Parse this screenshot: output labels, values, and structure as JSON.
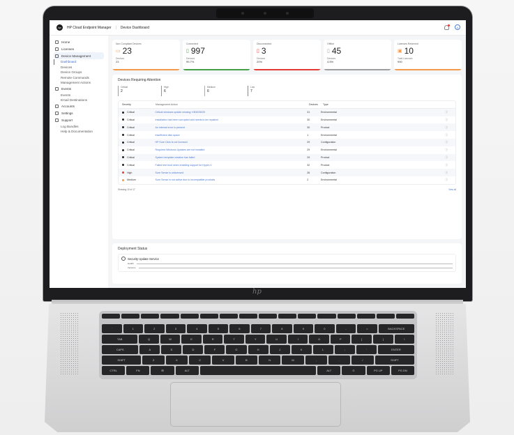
{
  "app": {
    "title": "HP Cloud Endpoint Manager",
    "page": "Device Dashboard",
    "logo_text": "hp",
    "avatar": "A"
  },
  "sidebar": {
    "items": [
      {
        "label": "Home",
        "icon": "home-icon"
      },
      {
        "label": "Licenses",
        "icon": "license-icon"
      },
      {
        "label": "Device Management",
        "icon": "device-icon",
        "active": true
      },
      {
        "label": "Events",
        "icon": "events-icon"
      },
      {
        "label": "Accounts",
        "icon": "accounts-icon"
      },
      {
        "label": "Settings",
        "icon": "settings-icon"
      },
      {
        "label": "Support",
        "icon": "support-icon"
      }
    ],
    "device_sub": [
      "Dashboard",
      "Devices",
      "Device Groups",
      "Remote Commands",
      "Management Actions"
    ],
    "events_sub": [
      "Events",
      "Email Destinations"
    ],
    "support_sub": [
      "Log Bundles",
      "Help & Documentation"
    ]
  },
  "cards": [
    {
      "title": "Non Compliant Devices",
      "value": "23",
      "sub_label": "Devices",
      "sub_value": "23",
      "color": "#f2994a"
    },
    {
      "title": "Connected",
      "value": "997",
      "sub_label": "Devices",
      "sub_value": "99.7%",
      "color": "#43a047"
    },
    {
      "title": "Disconnected",
      "value": "3",
      "sub_label": "Devices",
      "sub_value": "20%",
      "color": "#e53935"
    },
    {
      "title": "Offline",
      "value": "45",
      "sub_label": "Devices",
      "sub_value": "4.5%",
      "color": "#9e9e9e"
    },
    {
      "title": "Licenses Reserved",
      "value": "10",
      "sub_label": "Total Licenses",
      "sub_value": "990",
      "color": "#f2994a"
    }
  ],
  "attention": {
    "title": "Devices Requiring Attention",
    "severities": [
      {
        "label": "Critical",
        "count": "2",
        "color": "#9e9e9e"
      },
      {
        "label": "High",
        "count": "6",
        "color": "#e57373"
      },
      {
        "label": "Medium",
        "count": "6",
        "color": "#f2994a"
      },
      {
        "label": "Low",
        "count": "7",
        "color": "#5c8fd6"
      }
    ],
    "headers": {
      "severity": "Severity",
      "action": "Management Action",
      "devices": "Devices",
      "type": "Type"
    },
    "rows": [
      {
        "severity": "Critical",
        "action": "Critical windows update missing: KB3025029",
        "devices": "31",
        "type": "Environmental",
        "color": "#222222"
      },
      {
        "severity": "Critical",
        "action": "Installation has been corrupted and needs to be repaired",
        "devices": "30",
        "type": "Environmental",
        "color": "#222222"
      },
      {
        "severity": "Critical",
        "action": "An internal error is present",
        "devices": "30",
        "type": "Product",
        "color": "#222222"
      },
      {
        "severity": "Critical",
        "action": "Insufficient disk space",
        "devices": "1",
        "type": "Environmental",
        "color": "#222222"
      },
      {
        "severity": "Critical",
        "action": "HP Sure Click is not licensed",
        "devices": "29",
        "type": "Configuration",
        "color": "#222222"
      },
      {
        "severity": "Critical",
        "action": "Required Windows Updates are not installed",
        "devices": "29",
        "type": "Environmental",
        "color": "#222222"
      },
      {
        "severity": "Critical",
        "action": "System template creation has failed",
        "devices": "29",
        "type": "Product",
        "color": "#222222"
      },
      {
        "severity": "Critical",
        "action": "Failed test boot when enabling support for Hyper-V",
        "devices": "32",
        "type": "Product",
        "color": "#222222"
      },
      {
        "severity": "High",
        "action": "Sure Sense is unlicensed",
        "devices": "26",
        "type": "Configuration",
        "color": "#e53935"
      },
      {
        "severity": "Medium",
        "action": "Sure Sense is not active due to incompatible products",
        "devices": "2",
        "type": "Environmental",
        "color": "#f2994a"
      }
    ],
    "footer": "Showing 10 of 17",
    "view_all": "View all"
  },
  "deployment": {
    "title": "Deployment Status",
    "service": "Security Update Service",
    "lines": [
      "Health",
      "Versions"
    ]
  },
  "laptop": {
    "keys_row1": [
      "`",
      "1",
      "2",
      "3",
      "4",
      "5",
      "6",
      "7",
      "8",
      "9",
      "0",
      "-",
      "=",
      "BACKSPACE"
    ],
    "keys_row2": [
      "TAB",
      "Q",
      "W",
      "E",
      "R",
      "T",
      "Y",
      "U",
      "I",
      "O",
      "P",
      "[",
      "]",
      "\\"
    ],
    "keys_row3": [
      "CAPS",
      "A",
      "S",
      "D",
      "F",
      "G",
      "H",
      "J",
      "K",
      "L",
      ";",
      "'",
      "ENTER"
    ],
    "keys_row4": [
      "SHIFT",
      "Z",
      "X",
      "C",
      "V",
      "B",
      "N",
      "M",
      ",",
      ".",
      "/",
      "SHIFT"
    ],
    "keys_row5": [
      "CTRL",
      "FN",
      "⊞",
      "ALT",
      "",
      "ALT",
      "⊙",
      "PG UP",
      "PG DN"
    ]
  }
}
